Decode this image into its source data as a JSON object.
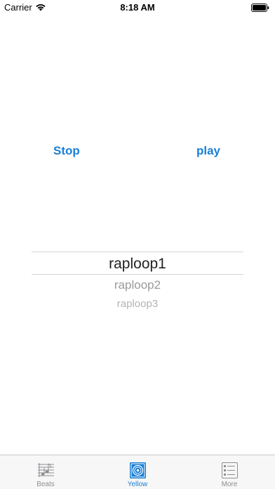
{
  "status_bar": {
    "carrier": "Carrier",
    "time": "8:18 AM"
  },
  "controls": {
    "stop_label": "Stop",
    "play_label": "play"
  },
  "picker": {
    "rows": [
      "raploop1",
      "raploop2",
      "raploop3"
    ],
    "selected_index": 0
  },
  "tab_bar": {
    "tabs": [
      {
        "label": "Beats",
        "icon": "music-score-icon",
        "selected": false
      },
      {
        "label": "Yellow",
        "icon": "speaker-icon",
        "selected": true
      },
      {
        "label": "More",
        "icon": "list-icon",
        "selected": false
      }
    ]
  },
  "colors": {
    "accent": "#1a7fd6",
    "inactive_tab": "#8e8e93"
  }
}
